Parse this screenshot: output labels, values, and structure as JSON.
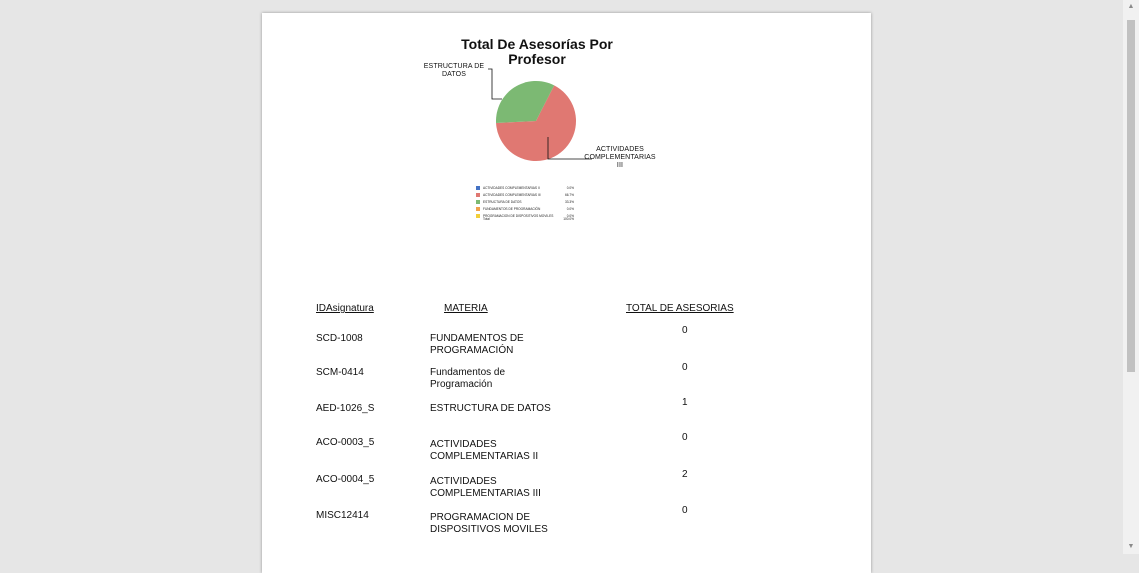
{
  "report": {
    "chart_title_line1": "Total De Asesorías Por",
    "chart_title_line2": "Profesor"
  },
  "chart_data": {
    "type": "pie",
    "title": "Total De Asesorías Por Profesor",
    "slices": [
      {
        "name": "ACTIVIDADES COMPLEMENTARIAS II",
        "value": 0.0,
        "label": "0.0%",
        "color": "#4472c4"
      },
      {
        "name": "ACTIVIDADES COMPLEMENTARIAS III",
        "value": 66.7,
        "label": "66.7%",
        "color": "#e07872"
      },
      {
        "name": "ESTRUCTURA DE DATOS",
        "value": 33.3,
        "label": "33.3%",
        "color": "#7cb973"
      },
      {
        "name": "FUNDAMENTOS DE PROGRAMACIÓN",
        "value": 0.0,
        "label": "0.0%",
        "color": "#f0a04b"
      },
      {
        "name": "PROGRAMACION DE DISPOSITIVOS MOVILES",
        "value": 0.0,
        "label": "0.0%",
        "color": "#f2cf3a"
      }
    ],
    "total_label": "Total",
    "total_value": "100.0%",
    "callouts": {
      "estructura_line1": "ESTRUCTURA DE",
      "estructura_line2": "DATOS",
      "actividades_line1": "ACTIVIDADES",
      "actividades_line2": "COMPLEMENTARIAS",
      "actividades_line3": "III"
    }
  },
  "table": {
    "headers": {
      "id": "IDAsignatura",
      "materia": "MATERIA",
      "total": "TOTAL DE ASESORIAS"
    },
    "rows": [
      {
        "id": "SCD-1008",
        "materia_line1": "FUNDAMENTOS DE",
        "materia_line2": "PROGRAMACIÓN",
        "total": "0"
      },
      {
        "id": "SCM-0414",
        "materia_line1": "Fundamentos de Programación",
        "materia_line2": "",
        "total": "0"
      },
      {
        "id": "AED-1026_S",
        "materia_line1": "ESTRUCTURA DE DATOS",
        "materia_line2": "",
        "total": "1"
      },
      {
        "id": "ACO-0003_5",
        "materia_line1": "ACTIVIDADES",
        "materia_line2": "COMPLEMENTARIAS II",
        "total": "0"
      },
      {
        "id": "ACO-0004_5",
        "materia_line1": "ACTIVIDADES",
        "materia_line2": "COMPLEMENTARIAS III",
        "total": "2"
      },
      {
        "id": "MISC12414",
        "materia_line1": "PROGRAMACION DE",
        "materia_line2": "DISPOSITIVOS MOVILES",
        "total": "0"
      }
    ]
  },
  "scrollbar": {
    "up_icon": "triangle-up",
    "down_icon": "triangle-down"
  }
}
